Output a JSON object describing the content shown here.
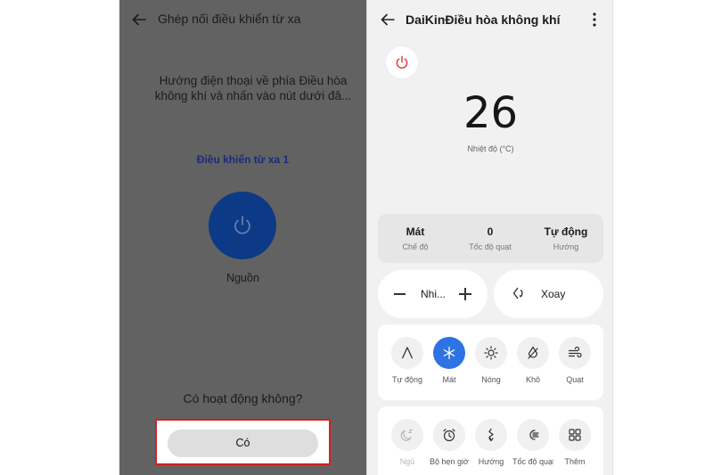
{
  "left_screen": {
    "title": "Ghép nối điều khiển từ xa",
    "instruction_line1": "Hướng điện thoại về phía Điều hòa",
    "instruction_line2": "không khí và nhấn vào nút dưới đâ...",
    "remote_name": "Điều khiển từ xa 1",
    "power_label": "Nguồn",
    "question": "Có hoạt động không?",
    "yes_button": "Có"
  },
  "right_screen": {
    "title": "DaiKinĐiều hòa không khí",
    "temperature": "26",
    "temperature_label": "Nhiệt độ (°C)",
    "status": [
      {
        "value": "Mát",
        "label": "Chế độ"
      },
      {
        "value": "0",
        "label": "Tốc độ quạt"
      },
      {
        "value": "Tự động",
        "label": "Hướng"
      }
    ],
    "temp_control_label": "Nhi...",
    "swing_label": "Xoay",
    "modes": [
      {
        "icon": "auto-mode-icon",
        "label": "Tự động",
        "active": false
      },
      {
        "icon": "snowflake-icon",
        "label": "Mát",
        "active": true
      },
      {
        "icon": "sun-icon",
        "label": "Nóng",
        "active": false
      },
      {
        "icon": "dry-drop-icon",
        "label": "Khô",
        "active": false
      },
      {
        "icon": "fan-wind-icon",
        "label": "Quạt",
        "active": false
      }
    ],
    "tools": [
      {
        "icon": "sleep-moon-icon",
        "label": "Ngủ"
      },
      {
        "icon": "alarm-clock-icon",
        "label": "Bộ hẹn giờ"
      },
      {
        "icon": "direction-icon",
        "label": "Hướng"
      },
      {
        "icon": "fan-speed-icon",
        "label": "Tốc độ quạt"
      },
      {
        "icon": "grid-more-icon",
        "label": "Thêm"
      }
    ],
    "colors": {
      "accent": "#2d73e3",
      "power_red": "#e0383e"
    }
  }
}
